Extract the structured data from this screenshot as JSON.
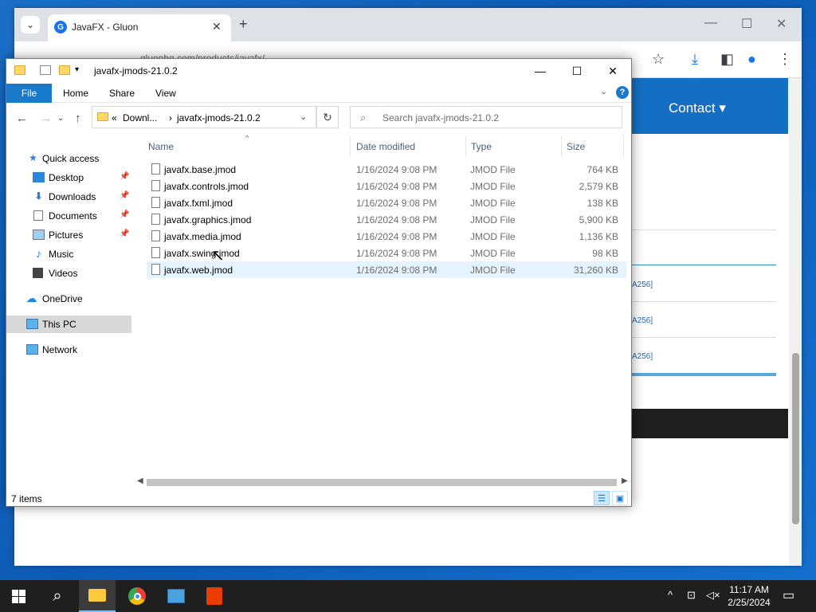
{
  "chrome": {
    "tab_title": "JavaFX - Gluon",
    "tab_favicon": "G",
    "address_partial": "gluonhq.com/products/javafx/",
    "site_nav_contact": "Contact",
    "site_links": [
      "A256]",
      "A256]",
      "A256]"
    ]
  },
  "explorer": {
    "title": "javafx-jmods-21.0.2",
    "ribbon": {
      "file": "File",
      "home": "Home",
      "share": "Share",
      "view": "View"
    },
    "address": {
      "overflow": "«",
      "parent": "Downl...",
      "separator": "›",
      "current": "javafx-jmods-21.0.2"
    },
    "search_placeholder": "Search javafx-jmods-21.0.2",
    "nav": {
      "quick_access": "Quick access",
      "desktop": "Desktop",
      "downloads": "Downloads",
      "documents": "Documents",
      "pictures": "Pictures",
      "music": "Music",
      "videos": "Videos",
      "onedrive": "OneDrive",
      "this_pc": "This PC",
      "network": "Network"
    },
    "columns": {
      "name": "Name",
      "date": "Date modified",
      "type": "Type",
      "size": "Size"
    },
    "files": [
      {
        "name": "javafx.base.jmod",
        "date": "1/16/2024 9:08 PM",
        "type": "JMOD File",
        "size": "764 KB"
      },
      {
        "name": "javafx.controls.jmod",
        "date": "1/16/2024 9:08 PM",
        "type": "JMOD File",
        "size": "2,579 KB"
      },
      {
        "name": "javafx.fxml.jmod",
        "date": "1/16/2024 9:08 PM",
        "type": "JMOD File",
        "size": "138 KB"
      },
      {
        "name": "javafx.graphics.jmod",
        "date": "1/16/2024 9:08 PM",
        "type": "JMOD File",
        "size": "5,900 KB"
      },
      {
        "name": "javafx.media.jmod",
        "date": "1/16/2024 9:08 PM",
        "type": "JMOD File",
        "size": "1,136 KB"
      },
      {
        "name": "javafx.swing.jmod",
        "date": "1/16/2024 9:08 PM",
        "type": "JMOD File",
        "size": "98 KB"
      },
      {
        "name": "javafx.web.jmod",
        "date": "1/16/2024 9:08 PM",
        "type": "JMOD File",
        "size": "31,260 KB"
      }
    ],
    "status": "7 items"
  },
  "taskbar": {
    "time": "11:17 AM",
    "date": "2/25/2024"
  },
  "colors": {
    "accent": "#1979ca",
    "site_nav": "#146fc4",
    "taskbar": "#1f1f1f"
  }
}
